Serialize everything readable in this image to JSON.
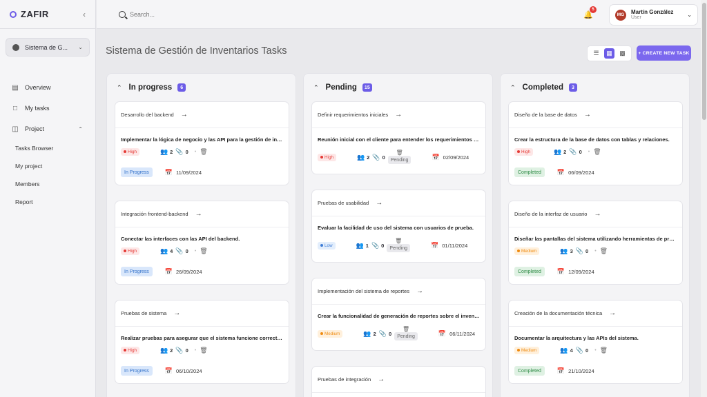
{
  "brand": {
    "name": "ZAFIR"
  },
  "sidebar": {
    "project_select": "Sistema de G...",
    "items": [
      {
        "label": "Overview",
        "icon": "chart-icon"
      },
      {
        "label": "My tasks",
        "icon": "document-icon"
      },
      {
        "label": "Project",
        "icon": "folder-icon"
      }
    ],
    "sub_items": [
      "Tasks Browser",
      "My project",
      "Members",
      "Report"
    ]
  },
  "topbar": {
    "search_placeholder": "Search...",
    "notifications": "5",
    "user": {
      "initials": "MG",
      "name": "Martín González",
      "role": "User"
    }
  },
  "main": {
    "title": "Sistema de Gestión de Inventarios Tasks",
    "create_label": "+ CREATE NEW TASK"
  },
  "columns": [
    {
      "title": "In progress",
      "count": "6",
      "cards": [
        {
          "title": "Desarrollo del backend",
          "desc": "Implementar la lógica de negocio y las API para la gestión de invent...",
          "priority": "High",
          "members": "2",
          "attachments": "0",
          "status": "In Progress",
          "date": "11/09/2024"
        },
        {
          "title": "Integración frontend-backend",
          "desc": "Conectar las interfaces con las API del backend.",
          "priority": "High",
          "members": "4",
          "attachments": "0",
          "status": "In Progress",
          "date": "26/09/2024"
        },
        {
          "title": "Pruebas de sistema",
          "desc": "Realizar pruebas para asegurar que el sistema funcione correctame...",
          "priority": "High",
          "members": "2",
          "attachments": "0",
          "status": "In Progress",
          "date": "06/10/2024"
        }
      ]
    },
    {
      "title": "Pending",
      "count": "15",
      "cards": [
        {
          "title": "Definir requerimientos iniciales",
          "desc": "Reunión inicial con el cliente para entender los requerimientos del si...",
          "priority": "High",
          "members": "2",
          "attachments": "0",
          "status": "Pending",
          "date": "02/09/2024"
        },
        {
          "title": "Pruebas de usabilidad",
          "desc": "Evaluar la facilidad de uso del sistema con usuarios de prueba.",
          "priority": "Low",
          "members": "1",
          "attachments": "0",
          "status": "Pending",
          "date": "01/11/2024"
        },
        {
          "title": "Implementación del sistema de reportes",
          "desc": "Crear la funcionalidad de generación de reportes sobre el inventario.",
          "priority": "Medium",
          "members": "2",
          "attachments": "0",
          "status": "Pending",
          "date": "06/11/2024"
        },
        {
          "title": "Pruebas de integración"
        }
      ]
    },
    {
      "title": "Completed",
      "count": "3",
      "cards": [
        {
          "title": "Diseño de la base de datos",
          "desc": "Crear la estructura de la base de datos con tablas y relaciones.",
          "priority": "High",
          "members": "2",
          "attachments": "0",
          "status": "Completed",
          "date": "06/09/2024"
        },
        {
          "title": "Diseño de la interfaz de usuario",
          "desc": "Diseñar las pantallas del sistema utilizando herramientas de prototi...",
          "priority": "Medium",
          "members": "3",
          "attachments": "0",
          "status": "Completed",
          "date": "12/09/2024"
        },
        {
          "title": "Creación de la documentación técnica",
          "desc": "Documentar la arquitectura y las APIs del sistema.",
          "priority": "Medium",
          "members": "4",
          "attachments": "0",
          "status": "Completed",
          "date": "21/10/2024"
        }
      ]
    }
  ],
  "colors": {
    "accent": "#6c5ce7",
    "high": "#e53935",
    "medium": "#ef8b10",
    "low": "#3d7cd6"
  }
}
